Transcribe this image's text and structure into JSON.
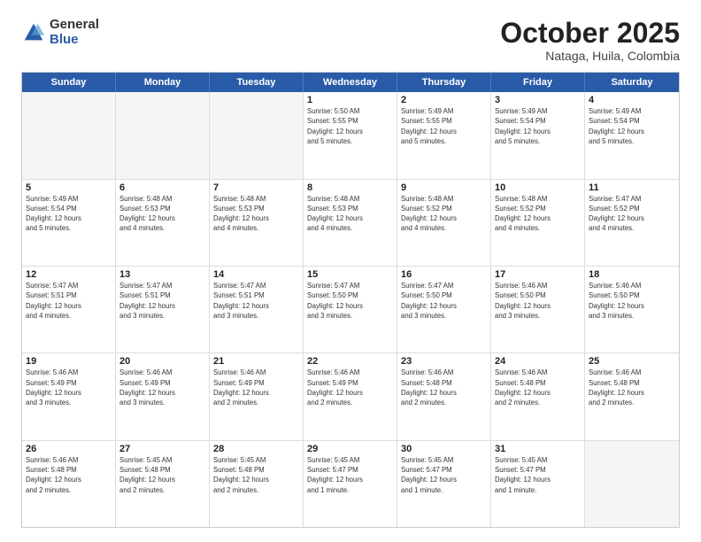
{
  "logo": {
    "general": "General",
    "blue": "Blue"
  },
  "header": {
    "month": "October 2025",
    "location": "Nataga, Huila, Colombia"
  },
  "weekdays": [
    "Sunday",
    "Monday",
    "Tuesday",
    "Wednesday",
    "Thursday",
    "Friday",
    "Saturday"
  ],
  "rows": [
    [
      {
        "day": "",
        "info": "",
        "empty": true
      },
      {
        "day": "",
        "info": "",
        "empty": true
      },
      {
        "day": "",
        "info": "",
        "empty": true
      },
      {
        "day": "1",
        "info": "Sunrise: 5:50 AM\nSunset: 5:55 PM\nDaylight: 12 hours\nand 5 minutes."
      },
      {
        "day": "2",
        "info": "Sunrise: 5:49 AM\nSunset: 5:55 PM\nDaylight: 12 hours\nand 5 minutes."
      },
      {
        "day": "3",
        "info": "Sunrise: 5:49 AM\nSunset: 5:54 PM\nDaylight: 12 hours\nand 5 minutes."
      },
      {
        "day": "4",
        "info": "Sunrise: 5:49 AM\nSunset: 5:54 PM\nDaylight: 12 hours\nand 5 minutes."
      }
    ],
    [
      {
        "day": "5",
        "info": "Sunrise: 5:49 AM\nSunset: 5:54 PM\nDaylight: 12 hours\nand 5 minutes."
      },
      {
        "day": "6",
        "info": "Sunrise: 5:48 AM\nSunset: 5:53 PM\nDaylight: 12 hours\nand 4 minutes."
      },
      {
        "day": "7",
        "info": "Sunrise: 5:48 AM\nSunset: 5:53 PM\nDaylight: 12 hours\nand 4 minutes."
      },
      {
        "day": "8",
        "info": "Sunrise: 5:48 AM\nSunset: 5:53 PM\nDaylight: 12 hours\nand 4 minutes."
      },
      {
        "day": "9",
        "info": "Sunrise: 5:48 AM\nSunset: 5:52 PM\nDaylight: 12 hours\nand 4 minutes."
      },
      {
        "day": "10",
        "info": "Sunrise: 5:48 AM\nSunset: 5:52 PM\nDaylight: 12 hours\nand 4 minutes."
      },
      {
        "day": "11",
        "info": "Sunrise: 5:47 AM\nSunset: 5:52 PM\nDaylight: 12 hours\nand 4 minutes."
      }
    ],
    [
      {
        "day": "12",
        "info": "Sunrise: 5:47 AM\nSunset: 5:51 PM\nDaylight: 12 hours\nand 4 minutes."
      },
      {
        "day": "13",
        "info": "Sunrise: 5:47 AM\nSunset: 5:51 PM\nDaylight: 12 hours\nand 3 minutes."
      },
      {
        "day": "14",
        "info": "Sunrise: 5:47 AM\nSunset: 5:51 PM\nDaylight: 12 hours\nand 3 minutes."
      },
      {
        "day": "15",
        "info": "Sunrise: 5:47 AM\nSunset: 5:50 PM\nDaylight: 12 hours\nand 3 minutes."
      },
      {
        "day": "16",
        "info": "Sunrise: 5:47 AM\nSunset: 5:50 PM\nDaylight: 12 hours\nand 3 minutes."
      },
      {
        "day": "17",
        "info": "Sunrise: 5:46 AM\nSunset: 5:50 PM\nDaylight: 12 hours\nand 3 minutes."
      },
      {
        "day": "18",
        "info": "Sunrise: 5:46 AM\nSunset: 5:50 PM\nDaylight: 12 hours\nand 3 minutes."
      }
    ],
    [
      {
        "day": "19",
        "info": "Sunrise: 5:46 AM\nSunset: 5:49 PM\nDaylight: 12 hours\nand 3 minutes."
      },
      {
        "day": "20",
        "info": "Sunrise: 5:46 AM\nSunset: 5:49 PM\nDaylight: 12 hours\nand 3 minutes."
      },
      {
        "day": "21",
        "info": "Sunrise: 5:46 AM\nSunset: 5:49 PM\nDaylight: 12 hours\nand 2 minutes."
      },
      {
        "day": "22",
        "info": "Sunrise: 5:46 AM\nSunset: 5:49 PM\nDaylight: 12 hours\nand 2 minutes."
      },
      {
        "day": "23",
        "info": "Sunrise: 5:46 AM\nSunset: 5:48 PM\nDaylight: 12 hours\nand 2 minutes."
      },
      {
        "day": "24",
        "info": "Sunrise: 5:46 AM\nSunset: 5:48 PM\nDaylight: 12 hours\nand 2 minutes."
      },
      {
        "day": "25",
        "info": "Sunrise: 5:46 AM\nSunset: 5:48 PM\nDaylight: 12 hours\nand 2 minutes."
      }
    ],
    [
      {
        "day": "26",
        "info": "Sunrise: 5:46 AM\nSunset: 5:48 PM\nDaylight: 12 hours\nand 2 minutes."
      },
      {
        "day": "27",
        "info": "Sunrise: 5:45 AM\nSunset: 5:48 PM\nDaylight: 12 hours\nand 2 minutes."
      },
      {
        "day": "28",
        "info": "Sunrise: 5:45 AM\nSunset: 5:48 PM\nDaylight: 12 hours\nand 2 minutes."
      },
      {
        "day": "29",
        "info": "Sunrise: 5:45 AM\nSunset: 5:47 PM\nDaylight: 12 hours\nand 1 minute."
      },
      {
        "day": "30",
        "info": "Sunrise: 5:45 AM\nSunset: 5:47 PM\nDaylight: 12 hours\nand 1 minute."
      },
      {
        "day": "31",
        "info": "Sunrise: 5:45 AM\nSunset: 5:47 PM\nDaylight: 12 hours\nand 1 minute."
      },
      {
        "day": "",
        "info": "",
        "empty": true,
        "shaded": true
      }
    ]
  ]
}
